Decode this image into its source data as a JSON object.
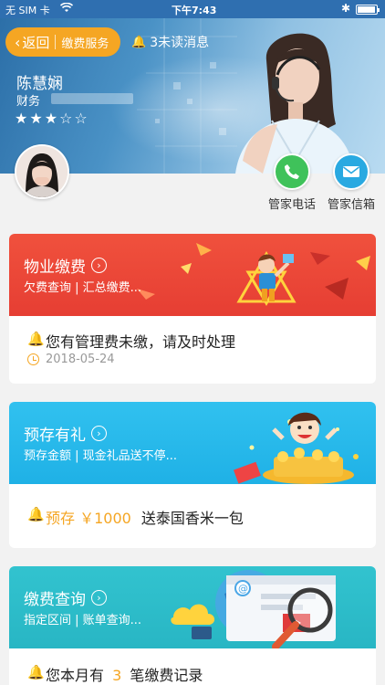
{
  "status_bar": {
    "carrier": "无 SIM 卡",
    "time": "下午7:43"
  },
  "header": {
    "back_label": "返回",
    "service_label": "缴费服务",
    "notice_text": "3未读消息"
  },
  "manager": {
    "name": "陈慧娴",
    "role": "财务",
    "rating": {
      "filled": 3,
      "total": 5,
      "stars": "★★★☆☆"
    }
  },
  "contacts": [
    {
      "label": "管家电话",
      "icon": "phone-icon",
      "color": "#3fc25a"
    },
    {
      "label": "管家信箱",
      "icon": "mail-icon",
      "color": "#29a9e1"
    }
  ],
  "cards": [
    {
      "title": "物业缴费",
      "subtitle": "欠费查询 | 汇总缴费...",
      "color": "#ea4336",
      "message": "您有管理费未缴，请及时处理",
      "date": "2018-05-24"
    },
    {
      "title": "预存有礼",
      "subtitle": "预存金额 | 现金礼品送不停...",
      "color": "#29b8ec",
      "message_prefix": "预存 ￥1000",
      "message_suffix": "送泰国香米一包"
    },
    {
      "title": "缴费查询",
      "subtitle": "指定区间 | 账单查询...",
      "color": "#2ebdca",
      "message_prefix": "您本月有",
      "message_count": "3",
      "message_suffix": "笔缴费记录"
    }
  ],
  "colors": {
    "accent": "#f5a623",
    "hero": "#3d84be"
  }
}
